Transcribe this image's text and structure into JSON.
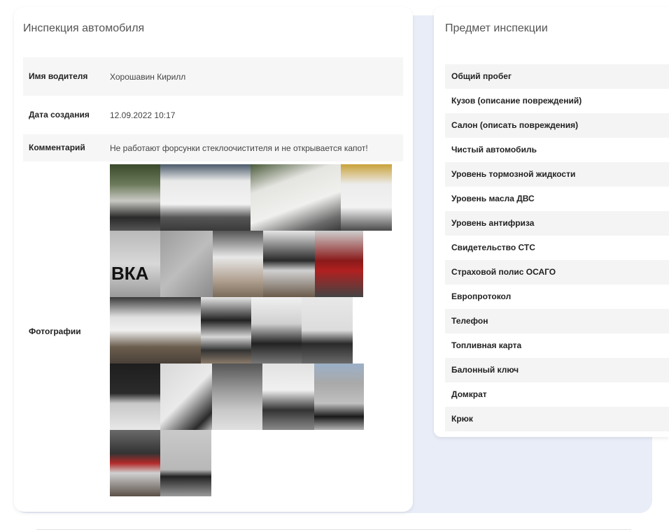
{
  "inspection": {
    "title": "Инспекция автомобиля",
    "rows": [
      {
        "label": "Имя водителя",
        "value": "Хорошавин Кирилл"
      },
      {
        "label": "Дата создания",
        "value": "12.09.2022 10:17"
      },
      {
        "label": "Комментарий",
        "value": "Не работают форсунки стеклоочистителя и не открывается капот!"
      },
      {
        "label": "Фотографии",
        "value": ""
      }
    ],
    "van_brand_text": "ВКА"
  },
  "subject": {
    "title": "Предмет инспекции",
    "items": [
      {
        "label": "Общий пробег"
      },
      {
        "label": "Кузов (описание повреждений)"
      },
      {
        "label": "Салон (описать повреждения)"
      },
      {
        "label": "Чистый автомобиль"
      },
      {
        "label": "Уровень тормозной жидкости"
      },
      {
        "label": "Уровень масла ДВС"
      },
      {
        "label": "Уровень антифриза"
      },
      {
        "label": "Свидетельство СТС"
      },
      {
        "label": "Страховой полис ОСАГО"
      },
      {
        "label": "Европротокол"
      },
      {
        "label": "Телефон"
      },
      {
        "label": "Топливная карта"
      },
      {
        "label": "Балонный ключ"
      },
      {
        "label": "Домкрат"
      },
      {
        "label": "Крюк"
      }
    ]
  }
}
